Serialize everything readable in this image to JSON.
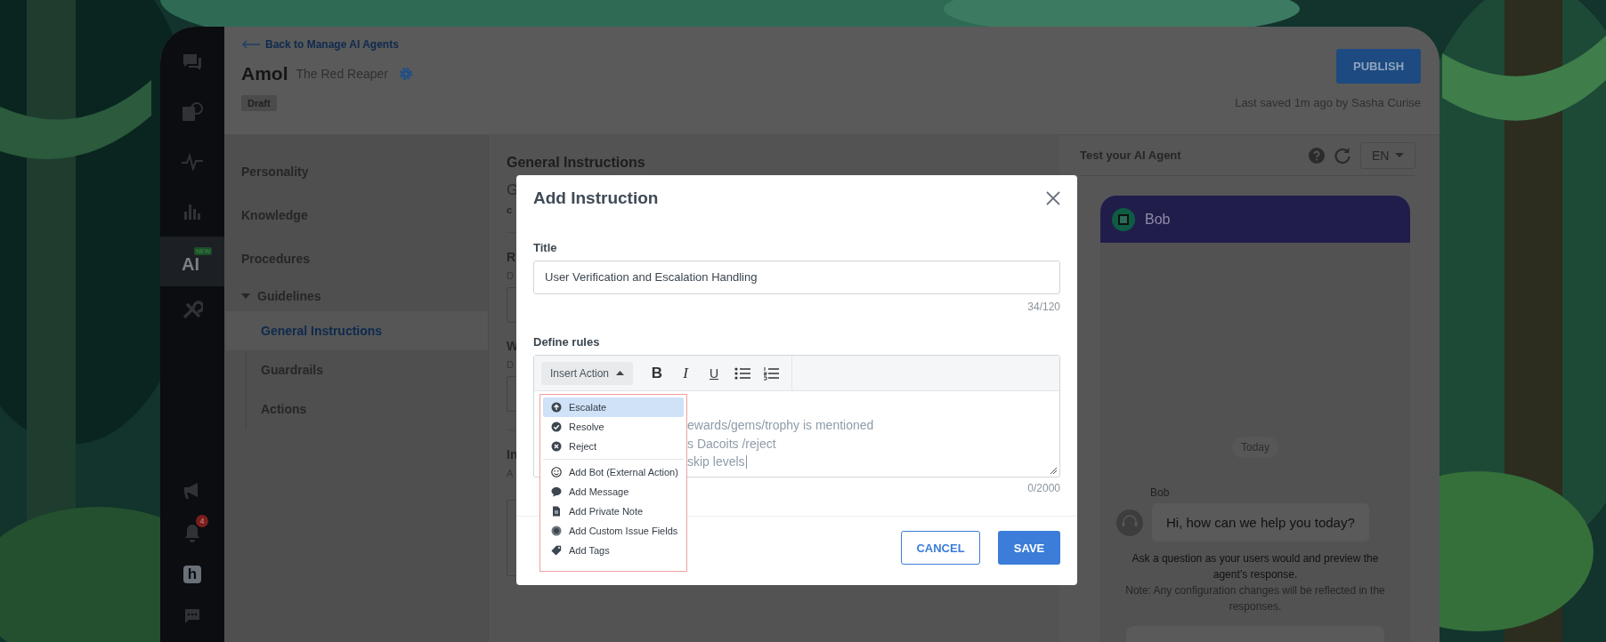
{
  "nav_rail": {
    "top": [
      {
        "kind": "chat",
        "selected": false
      },
      {
        "kind": "help-articles",
        "selected": false
      },
      {
        "kind": "activity",
        "selected": false
      },
      {
        "kind": "reports",
        "selected": false
      },
      {
        "kind": "ai",
        "label": "AI",
        "badge": "NEW",
        "selected": true
      },
      {
        "kind": "tools",
        "selected": false
      }
    ],
    "bottom": [
      {
        "kind": "announcements",
        "selected": false
      },
      {
        "kind": "notifications",
        "badge": "4",
        "selected": false
      },
      {
        "kind": "logo",
        "label": "h",
        "selected": false
      },
      {
        "kind": "messages",
        "selected": false
      }
    ]
  },
  "header": {
    "back_link": "Back to Manage AI Agents",
    "name": "Amol",
    "subtitle": "The Red Reaper",
    "status": "Draft",
    "publish_button": "PUBLISH",
    "last_saved": "Last saved 1m ago by Sasha Curise"
  },
  "sections_nav": {
    "items": [
      {
        "label": "Personality",
        "selected": false
      },
      {
        "label": "Knowledge",
        "selected": false
      },
      {
        "label": "Procedures",
        "selected": false
      },
      {
        "label": "Guidelines",
        "selected": false,
        "expanded": true,
        "children": [
          {
            "label": "General Instructions",
            "selected": true
          },
          {
            "label": "Guardrails",
            "selected": false
          },
          {
            "label": "Actions",
            "selected": false
          }
        ]
      }
    ]
  },
  "content": {
    "heading": "General Instructions",
    "fragments": [
      {
        "kind": "title",
        "text": "G"
      },
      {
        "kind": "caption",
        "text": "c"
      },
      {
        "kind": "divider"
      },
      {
        "kind": "label",
        "text": "R"
      },
      {
        "kind": "hint",
        "text": "D"
      },
      {
        "kind": "field"
      },
      {
        "kind": "label",
        "text": "W"
      },
      {
        "kind": "hint",
        "text": "D"
      },
      {
        "kind": "field"
      },
      {
        "kind": "divider"
      },
      {
        "kind": "label",
        "text": "In"
      },
      {
        "kind": "hint",
        "text": "A"
      },
      {
        "kind": "tall-field"
      }
    ]
  },
  "test_panel": {
    "title": "Test your AI Agent",
    "language": "EN",
    "chat": {
      "bot_name": "Bob",
      "date_divider": "Today",
      "sender": "Bob",
      "message": "Hi, how can we help you today?",
      "hint": "Ask a question as your users would and preview the agent’s response.",
      "note": "Note: Any configuration changes will be reflected in the responses."
    }
  },
  "modal": {
    "title": "Add Instruction",
    "title_label": "Title",
    "title_value": "User Verification and Escalation Handling",
    "title_count": "34/120",
    "rules_label": "Define rules",
    "insert_action": "Insert Action",
    "tools": [
      {
        "kind": "bold",
        "label": "B"
      },
      {
        "kind": "italic",
        "label": "I"
      },
      {
        "kind": "underline",
        "label": "U"
      },
      {
        "kind": "bullet-list"
      },
      {
        "kind": "numbered-list"
      }
    ],
    "editor_lines": [
      "ewards/gems/trophy is mentioned",
      "s Dacoits /reject",
      "skip levels"
    ],
    "rules_count": "0/2000",
    "cancel_button": "CANCEL",
    "save_button": "SAVE",
    "menu": {
      "groups": [
        [
          {
            "kind": "escalate",
            "label": "Escalate",
            "selected": true
          },
          {
            "kind": "resolve",
            "label": "Resolve",
            "selected": false
          },
          {
            "kind": "reject",
            "label": "Reject",
            "selected": false
          }
        ],
        [
          {
            "kind": "bot",
            "label": "Add Bot (External Action)",
            "selected": false
          },
          {
            "kind": "message",
            "label": "Add Message",
            "selected": false
          },
          {
            "kind": "note",
            "label": "Add Private Note",
            "selected": false
          },
          {
            "kind": "fields",
            "label": "Add Custom Issue Fields",
            "selected": false
          },
          {
            "kind": "tags",
            "label": "Add Tags",
            "selected": false
          }
        ]
      ]
    }
  }
}
